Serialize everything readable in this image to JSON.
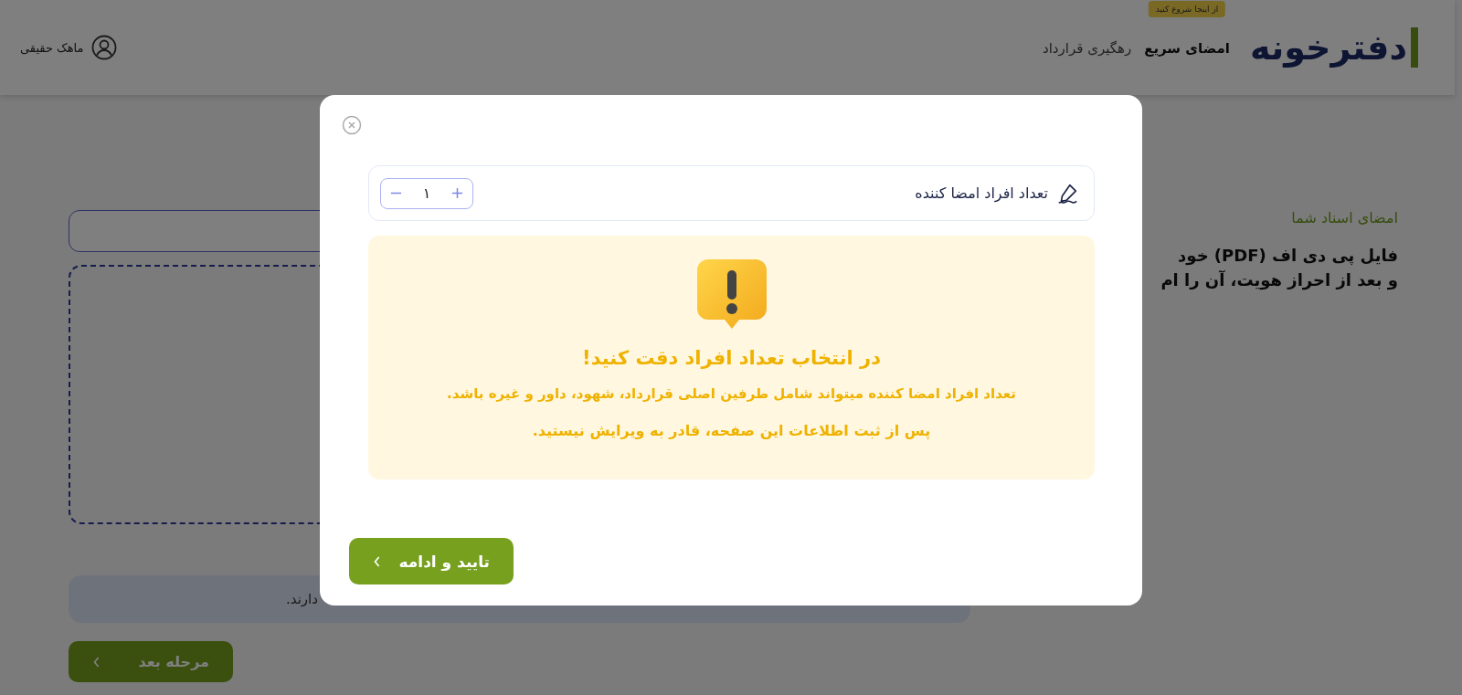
{
  "header": {
    "logo": "دفترخونه",
    "nav": [
      {
        "label": "امضای سریع",
        "selected": true,
        "badge": "از اینجا شروع کنید"
      },
      {
        "label": "رهگیری قرارداد",
        "selected": false
      }
    ],
    "user": "ماهک حقیقی"
  },
  "page": {
    "section_label": "امضای اسناد شما",
    "heading_lines": [
      "فایل پی دی اف (PDF) خود",
      "و بعد از احراز هویت، آن را ام"
    ],
    "info_text": "دارند.",
    "next_button": "مرحله بعد"
  },
  "dialog": {
    "counter": {
      "label": "تعداد افراد امضا کننده",
      "value": "۱"
    },
    "warning": {
      "title": "در انتخاب تعداد افراد دقت کنید!",
      "lines": [
        "تعداد افراد امضا کننده میتواند شامل طرفین اصلی قرارداد، شهود، داور و غیره باشد.",
        "پس از ثبت اطلاعات این صفحه، قادر به ویرایش نیستید."
      ]
    },
    "confirm_button": "تایید و ادامه"
  }
}
